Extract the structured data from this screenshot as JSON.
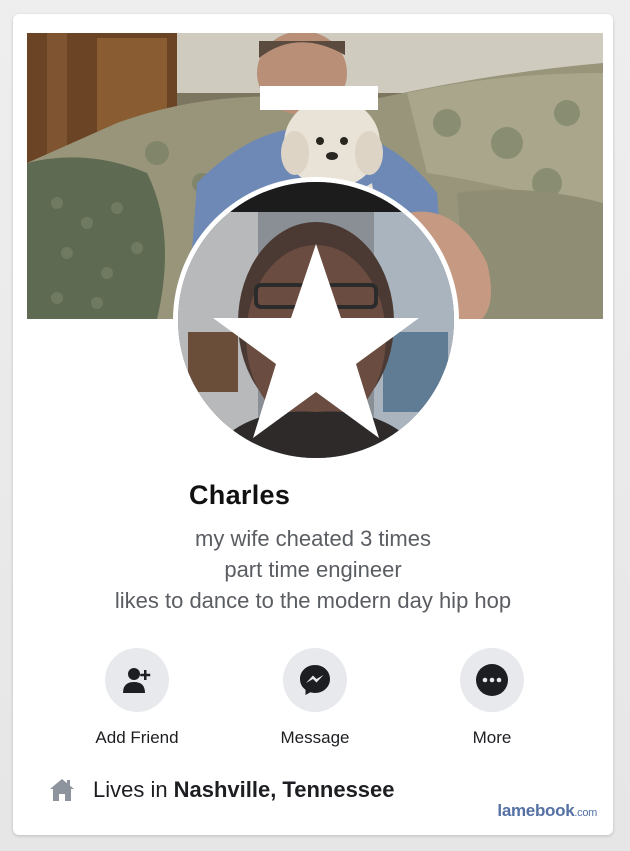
{
  "profile": {
    "name": "Charles",
    "bio": [
      "my wife cheated 3 times",
      "part time engineer",
      "likes to dance to the modern day hip hop"
    ]
  },
  "actions": {
    "add_friend": {
      "label": "Add Friend",
      "icon": "add-friend-icon"
    },
    "message": {
      "label": "Message",
      "icon": "messenger-icon"
    },
    "more": {
      "label": "More",
      "icon": "more-icon"
    }
  },
  "lives": {
    "prefix": "Lives in",
    "city": "Nashville, Tennessee",
    "icon": "home-icon"
  },
  "watermark": {
    "brand": "lamebook",
    "domain": ".com"
  },
  "colors": {
    "button_bg": "#e7e9ed",
    "icon_dark": "#1c1e21",
    "bio_text": "#5a5d62",
    "watermark": "#5470a4"
  }
}
